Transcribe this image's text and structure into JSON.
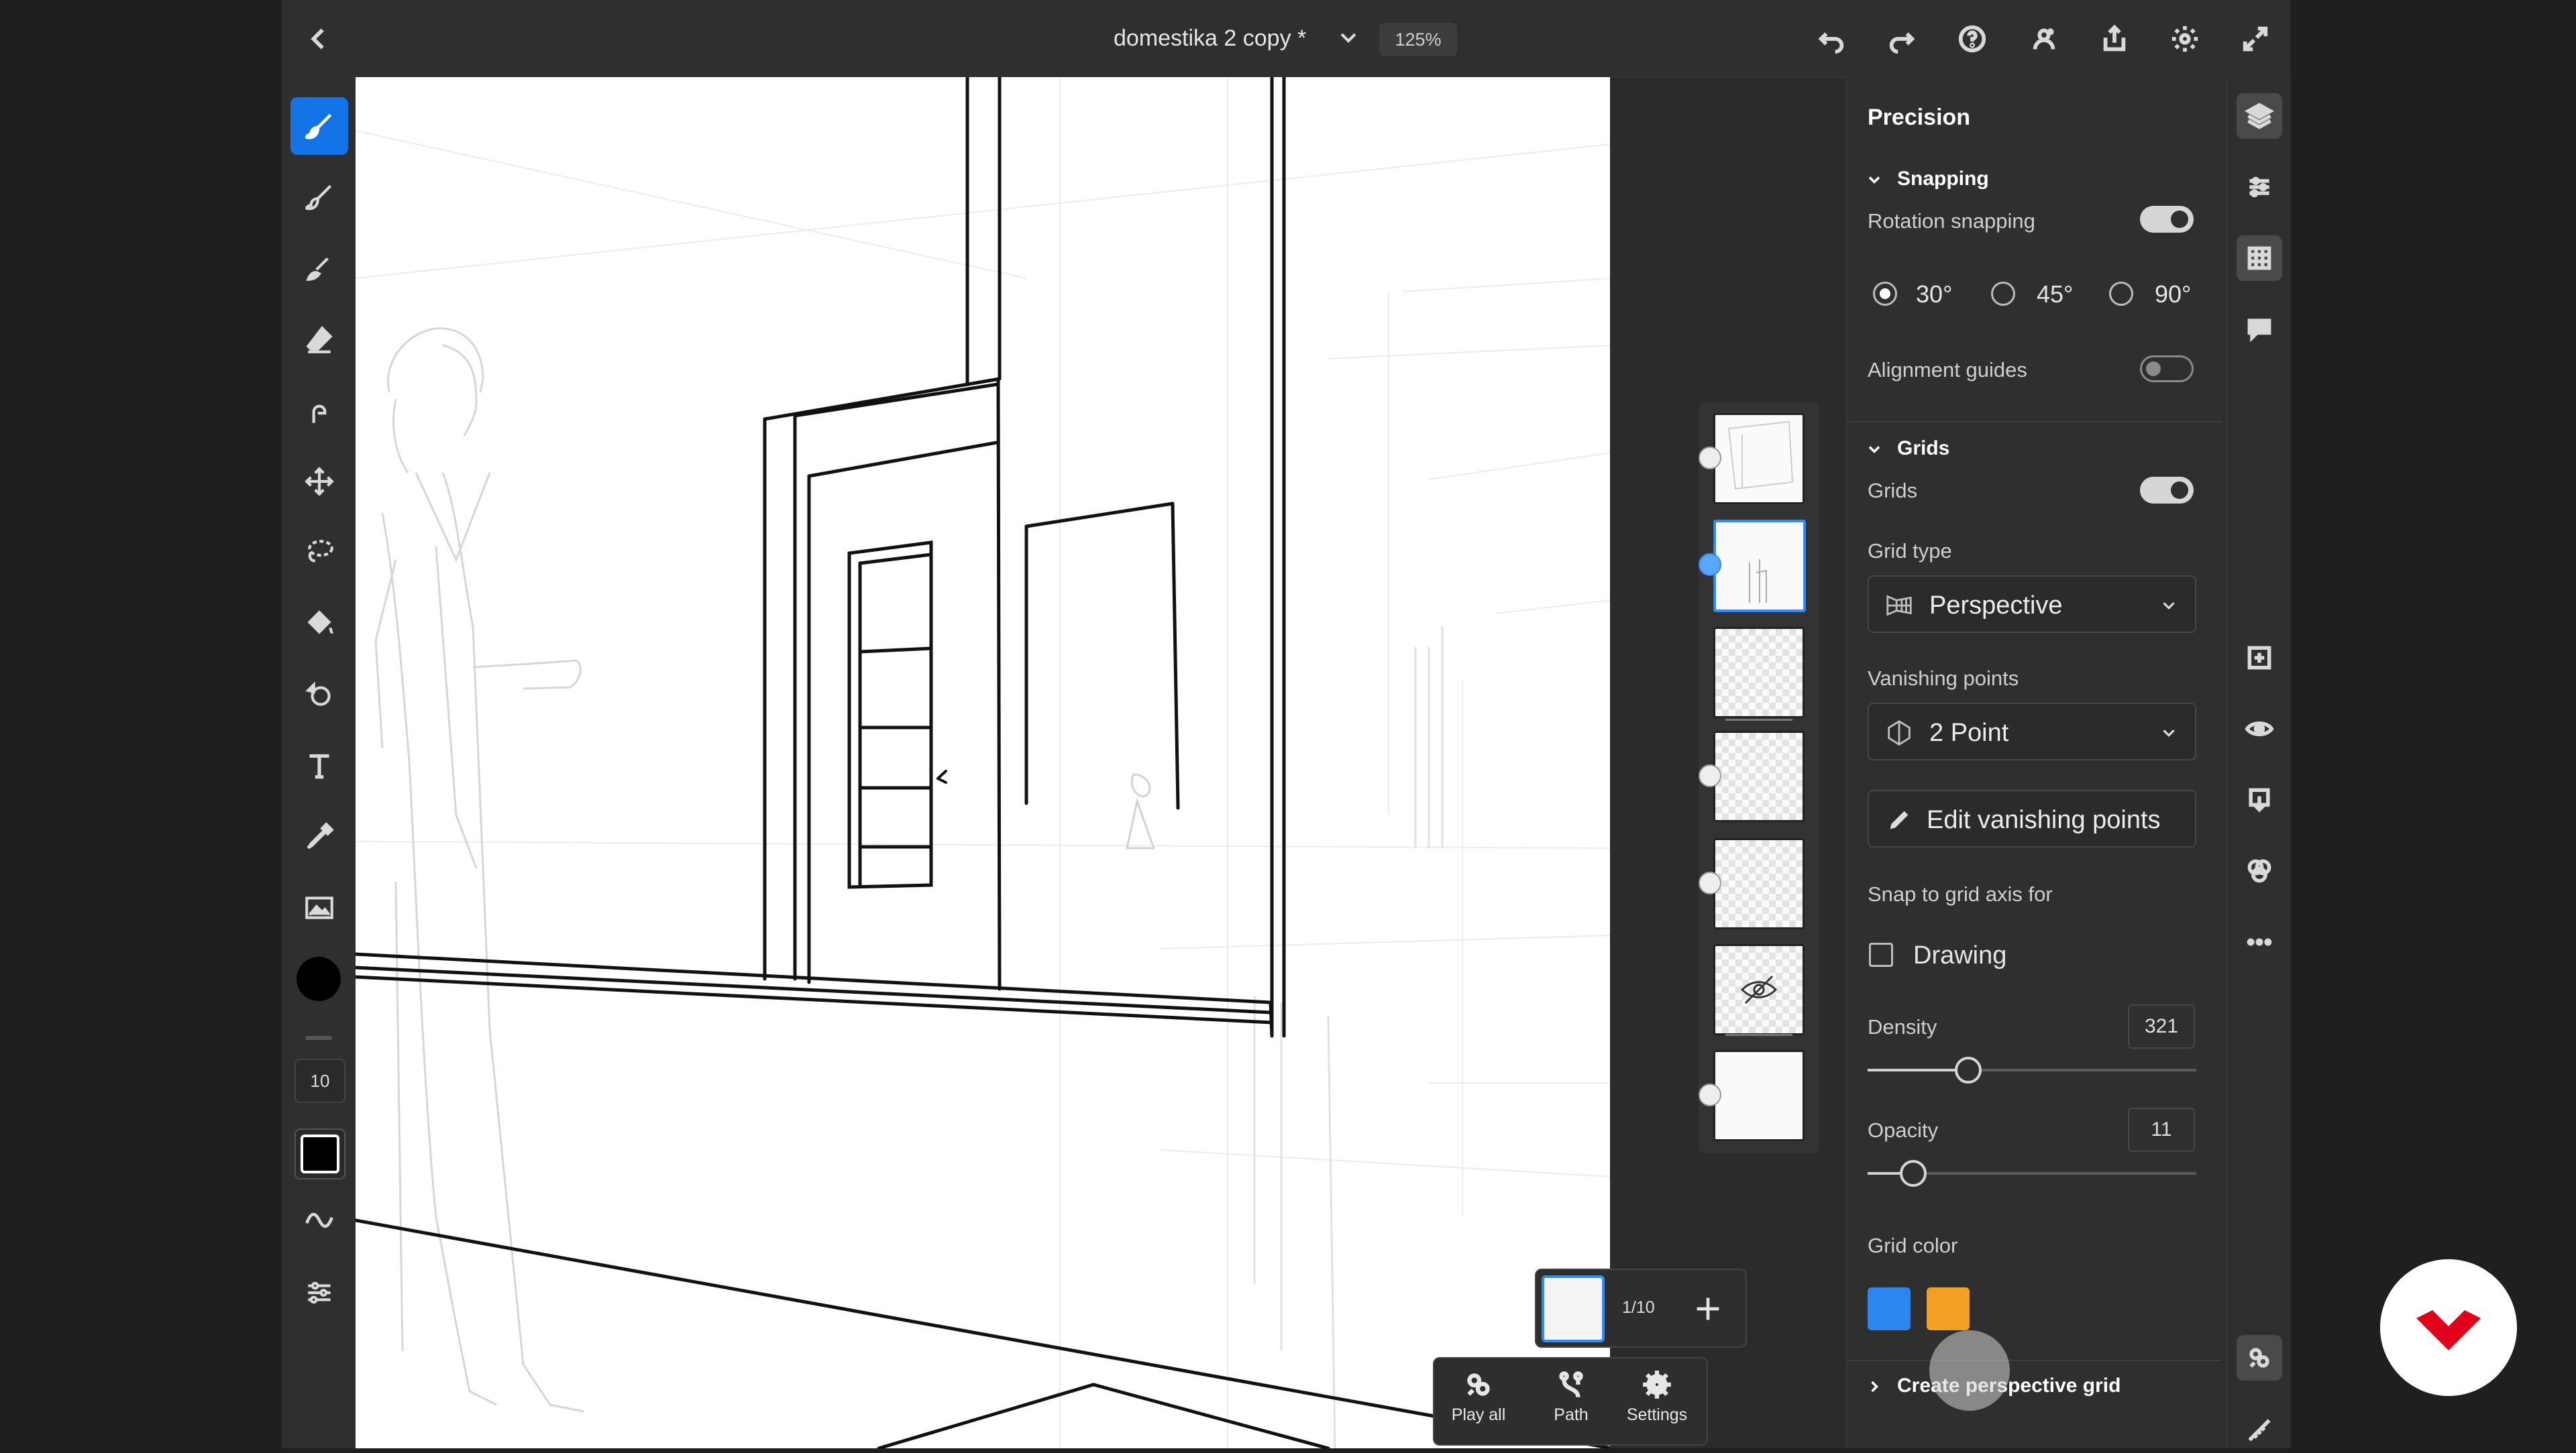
{
  "header": {
    "title": "domestika 2 copy *",
    "zoom": "125%"
  },
  "toolbar": {
    "brush_size": "10"
  },
  "timeline": {
    "frame_count": "1/10",
    "play_all": "Play all",
    "path": "Path",
    "settings": "Settings"
  },
  "panel": {
    "title": "Precision",
    "snapping": {
      "header": "Snapping",
      "rotation_snapping": "Rotation snapping",
      "rotation_snapping_on": true,
      "angles": [
        "30°",
        "45°",
        "90°"
      ],
      "selected_angle": "30°",
      "alignment_guides": "Alignment guides",
      "alignment_guides_on": false
    },
    "grids": {
      "header": "Grids",
      "grids_label": "Grids",
      "grids_on": true,
      "grid_type_label": "Grid type",
      "grid_type": "Perspective",
      "vanishing_points_label": "Vanishing points",
      "vanishing_points": "2 Point",
      "edit_vp": "Edit vanishing points",
      "snap_axis_label": "Snap to grid axis for",
      "drawing": "Drawing",
      "density_label": "Density",
      "density": "321",
      "opacity_label": "Opacity",
      "opacity": "11",
      "grid_color_label": "Grid color",
      "colors": [
        "#2d86f0",
        "#f2a023"
      ]
    },
    "create_perspective": "Create perspective grid"
  }
}
